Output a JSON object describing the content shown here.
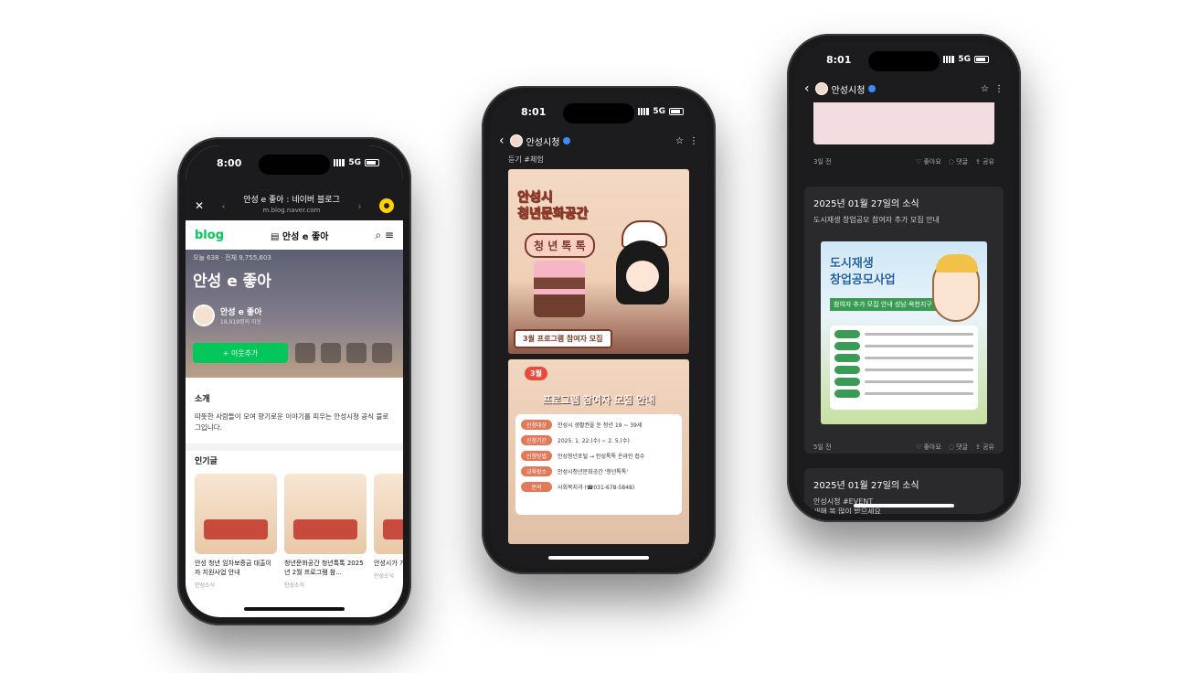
{
  "phone1": {
    "status": {
      "time": "8:00",
      "network": "5G"
    },
    "nav": {
      "title": "안성 e 좋아 : 네이버 블로그",
      "url": "m.blog.naver.com"
    },
    "blogbar": {
      "logo": "blog",
      "title": "안성 e 좋아"
    },
    "hero": {
      "meta": "오늘 638 · 전체 9,755,603",
      "title": "안성 e 좋아",
      "profile_name": "안성 e 좋아",
      "profile_sub": "18,919명의 이웃",
      "follow_label": "+ 이웃추가"
    },
    "intro": {
      "heading": "소개",
      "text": "따뜻한 사람들이 모여 향기로운 이야기를 피우는 안성시청 공식 블로그입니다."
    },
    "popular": {
      "heading": "인기글",
      "cards": [
        {
          "title": "안성 청년 임차보증금 대출이자 지원사업 안내",
          "category": "안성소식"
        },
        {
          "title": "청년문화공간 청년톡톡 2025년 2월 프로그램 참...",
          "category": "안성소식"
        },
        {
          "title": "안성시가 가사돌보...",
          "category": "안성소식"
        }
      ]
    }
  },
  "phone2": {
    "status": {
      "time": "8:01",
      "network": "5G"
    },
    "account": "안성시청",
    "tags": "듣기 #체험",
    "imgA": {
      "title_line1": "안성시",
      "title_line2": "청년문화공간",
      "pill": "청 년 톡 톡",
      "caption": "3월 프로그램 참여자 모집"
    },
    "imgB": {
      "badge": "3월",
      "heading": "프로그램 참여자 모집 안내",
      "rows": [
        {
          "label": "신청대상",
          "value": "안성시 생활권을 둔 청년 19 ~ 39세"
        },
        {
          "label": "신청기간",
          "value": "2025. 1. 22.(수) ~ 2. 5.(수)"
        },
        {
          "label": "신청방법",
          "value": "안성청년포털 → 안성톡톡 온라인 접수"
        },
        {
          "label": "교육장소",
          "value": "안성시청년문화공간 '청년톡톡'"
        },
        {
          "label": "문의",
          "value": "사회복지과 (☎031-678-5848)"
        }
      ]
    }
  },
  "phone3": {
    "status": {
      "time": "8:01",
      "network": "5G"
    },
    "account": "안성시청",
    "meta1": {
      "age": "3일 전",
      "like": "좋아요",
      "comment": "댓글",
      "share": "공유"
    },
    "post1": {
      "title": "2025년 01월 27일의 소식",
      "subtitle": "도시재생 창업공모 참여자 추가 모집 안내"
    },
    "poster": {
      "line1": "도시재생",
      "line2": "창업공모사업",
      "strip": "참여자 추가 모집 안내 성남·옥천지구 도시재생"
    },
    "meta2": {
      "age": "5일 전",
      "like": "좋아요",
      "comment": "댓글",
      "share": "공유"
    },
    "post2": {
      "title": "2025년 01월 27일의 소식",
      "subtitle": "안성시청 #EVENT",
      "line3": "새해 복 많이 받으세요"
    }
  }
}
